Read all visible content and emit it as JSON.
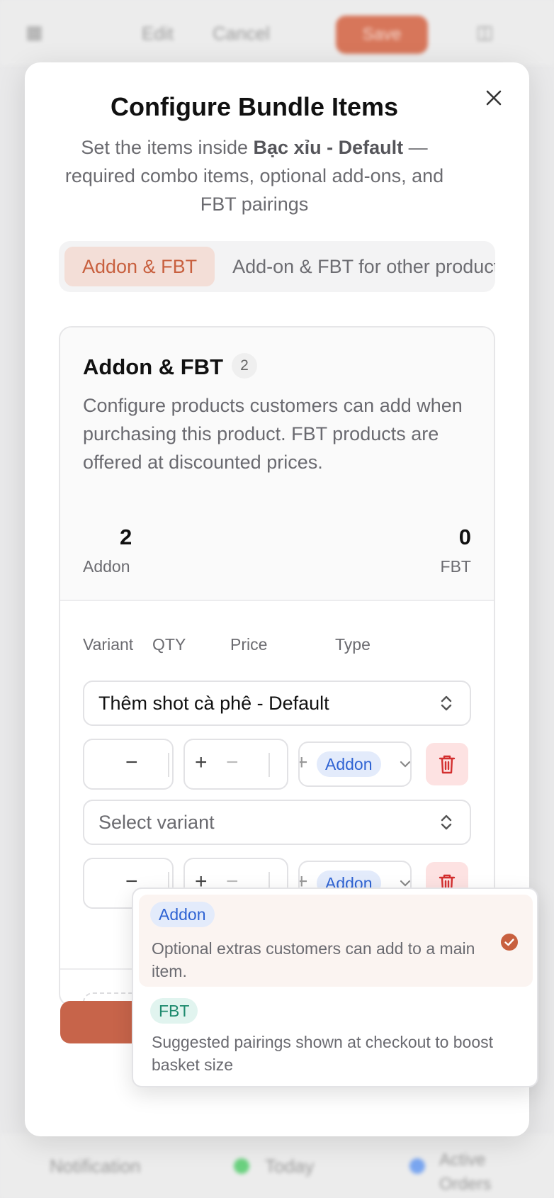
{
  "background": {
    "topbar_items": [
      "Edit",
      "Cancel",
      "Save"
    ],
    "bottombar_items": [
      "Notification",
      "Today",
      "Active Orders"
    ]
  },
  "modal": {
    "title": "Configure Bundle Items",
    "subtitle_prefix": "Set the items inside ",
    "subtitle_bold": "Bạc xỉu - Default",
    "subtitle_suffix": " — required combo items, optional add-ons, and FBT pairings",
    "tabs": [
      {
        "label": "Addon & FBT",
        "active": true
      },
      {
        "label": "Add-on & FBT for other products",
        "active": false
      }
    ],
    "section": {
      "title": "Addon & FBT",
      "count": "2",
      "description": "Configure products customers can add when purchasing this product. FBT products are offered at discounted prices.",
      "stats": [
        {
          "value": "2",
          "label": "Addon"
        },
        {
          "value": "0",
          "label": "FBT"
        }
      ],
      "columns": [
        "Variant",
        "QTY",
        "Price",
        "Type"
      ],
      "rows": [
        {
          "variant": "Thêm shot cà phê - Default",
          "type": "Addon"
        },
        {
          "variant": "Select variant",
          "type": "Addon"
        }
      ]
    }
  },
  "dropdown": {
    "options": [
      {
        "label": "Addon",
        "description": "Optional extras customers can add to a main item.",
        "selected": true
      },
      {
        "label": "FBT",
        "description": "Suggested pairings shown at checkout to boost basket size",
        "selected": false
      }
    ]
  },
  "colors": {
    "accent": "#c8603f",
    "addon_pill_bg": "#e3ebfb",
    "addon_pill_text": "#2f63d3",
    "fbt_pill_bg": "#e1f4ef",
    "fbt_pill_text": "#1e8a6e",
    "danger": "#d32f2f"
  }
}
